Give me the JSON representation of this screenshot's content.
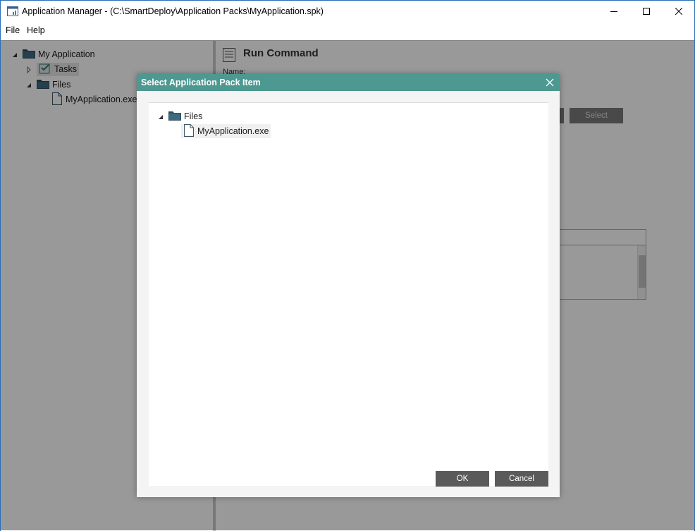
{
  "window": {
    "title": "Application Manager - (C:\\SmartDeploy\\Application Packs\\MyApplication.spk)",
    "accent": "#2b6fb6"
  },
  "menu": {
    "file": "File",
    "help": "Help"
  },
  "left_tree": {
    "root": "My Application",
    "tasks": "Tasks",
    "files": "Files",
    "file_item": "MyApplication.exe"
  },
  "right_pane": {
    "title": "Run Command",
    "name_label": "Name:",
    "select_button": "Select"
  },
  "dialog": {
    "title": "Select Application Pack Item",
    "title_color": "#4d9891",
    "tree": {
      "folder": "Files",
      "file": "MyApplication.exe"
    },
    "ok": "OK",
    "cancel": "Cancel"
  }
}
